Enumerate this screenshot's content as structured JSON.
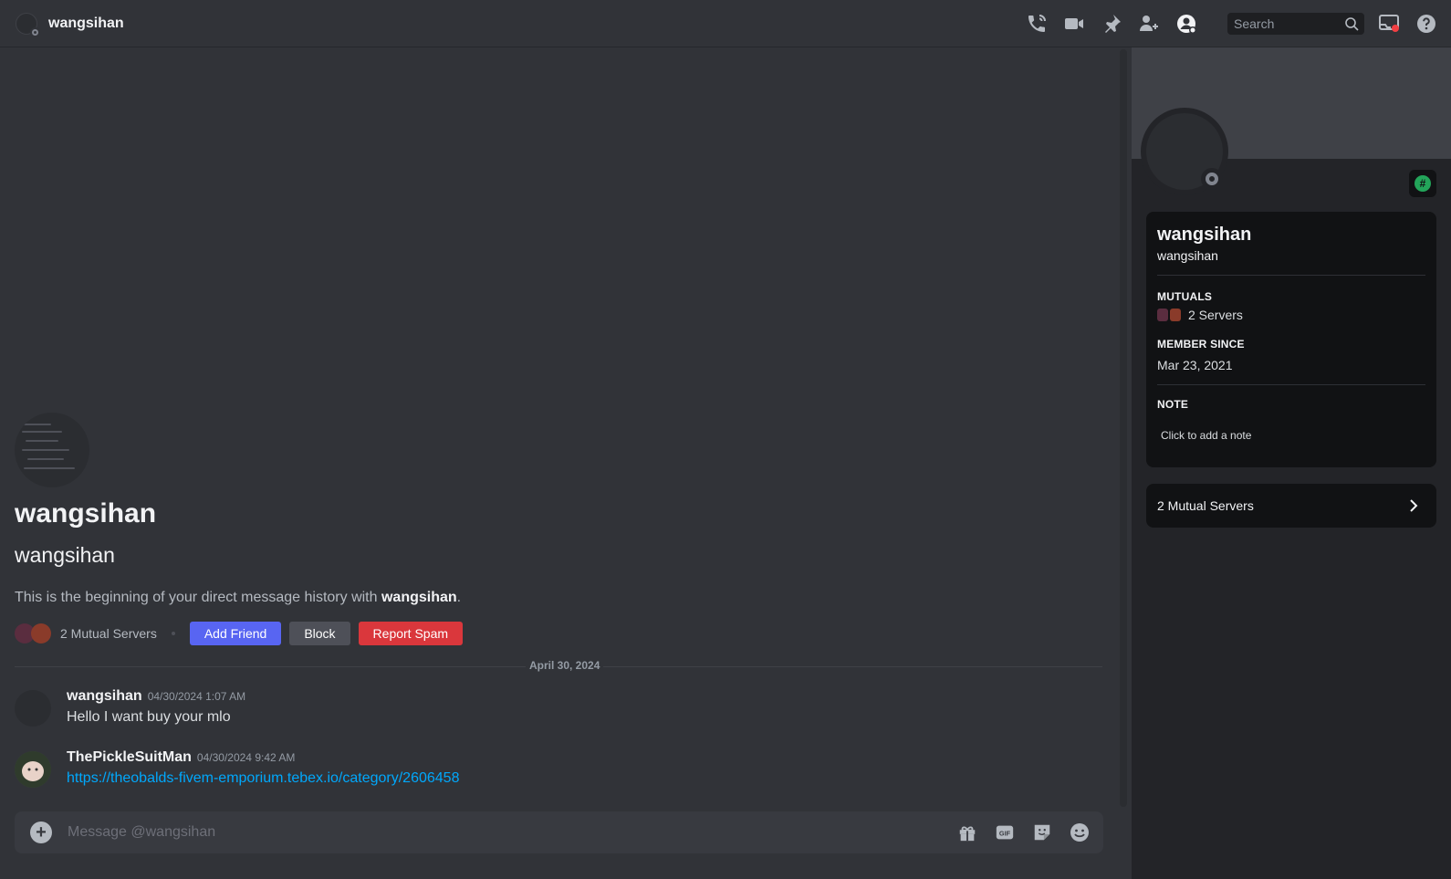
{
  "header": {
    "title": "wangsihan",
    "search_placeholder": "Search",
    "icons": [
      "voice-call-icon",
      "video-call-icon",
      "pinned-messages-icon",
      "add-friends-to-dm-icon",
      "user-profile-icon",
      "inbox-icon",
      "help-icon"
    ]
  },
  "intro": {
    "display_name": "wangsihan",
    "username": "wangsihan",
    "text_before": "This is the beginning of your direct message history with ",
    "text_name": "wangsihan",
    "text_after": ".",
    "mutual_servers": "2 Mutual Servers",
    "add_friend": "Add Friend",
    "block": "Block",
    "report_spam": "Report Spam"
  },
  "date_divider": "April 30, 2024",
  "messages": [
    {
      "author": "wangsihan",
      "time": "04/30/2024 1:07 AM",
      "content": "Hello  I want buy your mlo"
    },
    {
      "author": "ThePickleSuitMan",
      "time": "04/30/2024 9:42 AM",
      "content": "https://theobalds-fivem-emporium.tebex.io/category/2606458"
    }
  ],
  "composer": {
    "placeholder": "Message @wangsihan",
    "icons": [
      "attach-plus-icon",
      "gift-icon",
      "gif-icon",
      "sticker-icon",
      "emoji-icon"
    ]
  },
  "profile": {
    "display_name": "wangsihan",
    "username": "wangsihan",
    "mutuals_label": "MUTUALS",
    "mutuals_value": "2 Servers",
    "member_since_label": "MEMBER SINCE",
    "member_since_value": "Mar 23, 2021",
    "note_label": "NOTE",
    "note_placeholder": "Click to add a note",
    "mutual_servers_row": "2 Mutual Servers"
  },
  "colors": {
    "accent": "#5865f2",
    "danger": "#da373c",
    "link": "#00a8fc",
    "badge_green": "#23a55a"
  }
}
